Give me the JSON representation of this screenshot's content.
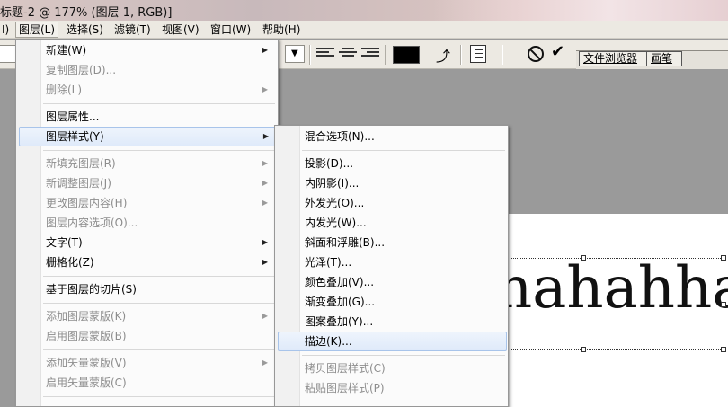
{
  "window": {
    "title": "标题-2 @ 177% (图层 1, RGB)]"
  },
  "menubar": [
    {
      "label": "I)"
    },
    {
      "label": "图层(L)"
    },
    {
      "label": "选择(S)"
    },
    {
      "label": "滤镜(T)"
    },
    {
      "label": "视图(V)"
    },
    {
      "label": "窗口(W)"
    },
    {
      "label": "帮助(H)"
    }
  ],
  "toolbar": {
    "dropdown_arrow": "▼",
    "text_color": "#000000",
    "well_tabs": [
      {
        "label": "文件浏览器"
      },
      {
        "label": "画笔"
      }
    ]
  },
  "canvas": {
    "text": "hahahha"
  },
  "layer_menu": {
    "items": [
      {
        "label": "新建(W)",
        "submenu": true
      },
      {
        "label": "复制图层(D)...",
        "disabled": true
      },
      {
        "label": "删除(L)",
        "disabled": true,
        "submenu": true
      },
      {
        "label": "图层属性..."
      },
      {
        "label": "图层样式(Y)",
        "submenu": true,
        "highlighted": true
      },
      {
        "label": "新填充图层(R)",
        "disabled": true,
        "submenu": true
      },
      {
        "label": "新调整图层(J)",
        "disabled": true,
        "submenu": true
      },
      {
        "label": "更改图层内容(H)",
        "disabled": true,
        "submenu": true
      },
      {
        "label": "图层内容选项(O)...",
        "disabled": true
      },
      {
        "label": "文字(T)",
        "submenu": true
      },
      {
        "label": "栅格化(Z)",
        "submenu": true
      },
      {
        "label": "基于图层的切片(S)"
      },
      {
        "label": "添加图层蒙版(K)",
        "disabled": true,
        "submenu": true
      },
      {
        "label": "启用图层蒙版(B)",
        "disabled": true
      },
      {
        "label": "添加矢量蒙版(V)",
        "disabled": true,
        "submenu": true
      },
      {
        "label": "启用矢量蒙版(C)",
        "disabled": true
      }
    ]
  },
  "style_menu": {
    "items": [
      {
        "label": "混合选项(N)..."
      },
      {
        "label": "投影(D)..."
      },
      {
        "label": "内阴影(I)..."
      },
      {
        "label": "外发光(O)..."
      },
      {
        "label": "内发光(W)..."
      },
      {
        "label": "斜面和浮雕(B)..."
      },
      {
        "label": "光泽(T)..."
      },
      {
        "label": "颜色叠加(V)..."
      },
      {
        "label": "渐变叠加(G)..."
      },
      {
        "label": "图案叠加(Y)..."
      },
      {
        "label": "描边(K)...",
        "highlighted": true
      },
      {
        "label": "拷贝图层样式(C)",
        "disabled": true
      },
      {
        "label": "粘贴图层样式(P)",
        "disabled": true
      }
    ]
  }
}
